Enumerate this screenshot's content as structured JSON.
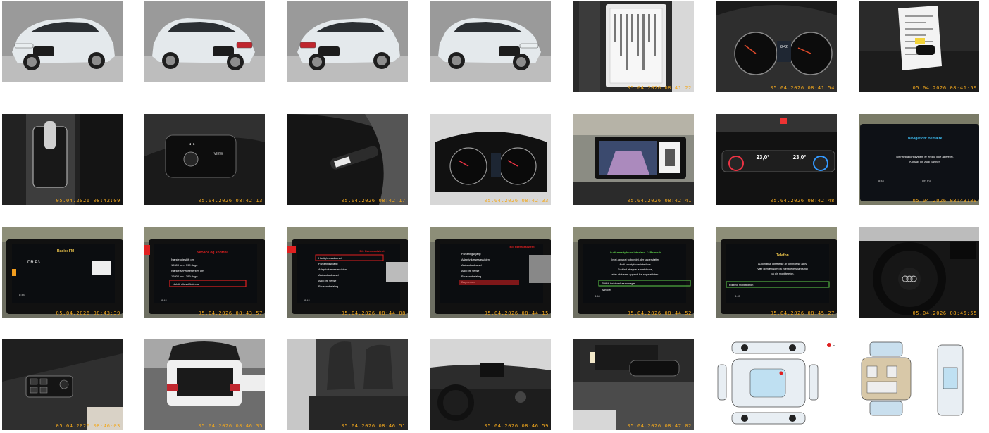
{
  "gallery": {
    "photos": [
      {
        "kind": "car-front-left",
        "stamp": ""
      },
      {
        "kind": "car-rear-left",
        "stamp": ""
      },
      {
        "kind": "car-rear-right",
        "stamp": ""
      },
      {
        "kind": "car-front-right",
        "stamp": ""
      },
      {
        "kind": "vin-plate",
        "stamp": "05.04.2026 08:41:22"
      },
      {
        "kind": "instrument-cluster",
        "stamp": "05.04.2026 08:41:54"
      },
      {
        "kind": "key-and-papers",
        "stamp": "05.04.2026 08:41:59"
      },
      {
        "kind": "gear-selector",
        "stamp": "05.04.2026 08:42:09"
      },
      {
        "kind": "steering-wheel-buttons",
        "stamp": "05.04.2026 08:42:13"
      },
      {
        "kind": "wiper-stalk",
        "stamp": "05.04.2026 08:42:17"
      },
      {
        "kind": "dashboard-gauges",
        "stamp": "05.04.2026 08:42:33"
      },
      {
        "kind": "reverse-camera-screen",
        "stamp": "05.04.2026 08:42:41"
      },
      {
        "kind": "climate-control",
        "stamp": "05.04.2026 08:42:48"
      },
      {
        "kind": "navigation-screen",
        "stamp": "05.04.2026 08:43:09"
      },
      {
        "kind": "radio-screen",
        "stamp": "05.04.2026 08:43:39"
      },
      {
        "kind": "service-screen",
        "stamp": "05.04.2026 08:43:57"
      },
      {
        "kind": "assist-menu-screen",
        "stamp": "05.04.2026 08:44:08"
      },
      {
        "kind": "assist-menu-screen-2",
        "stamp": "05.04.2026 08:44:15"
      },
      {
        "kind": "smartphone-screen",
        "stamp": "05.04.2026 08:44:52"
      },
      {
        "kind": "telefon-screen",
        "stamp": "05.04.2026 08:45:27"
      },
      {
        "kind": "steering-wheel-interior",
        "stamp": "05.04.2026 08:45:55"
      },
      {
        "kind": "door-window-controls",
        "stamp": "05.04.2026 08:46:03"
      },
      {
        "kind": "open-trunk",
        "stamp": "05.04.2026 08:46:35"
      },
      {
        "kind": "rear-seats",
        "stamp": "05.04.2026 08:46:51"
      },
      {
        "kind": "front-dashboard",
        "stamp": "05.04.2026 08:46:59"
      },
      {
        "kind": "interior-mirror",
        "stamp": "05.04.2026 08:47:02"
      },
      {
        "kind": "damage-diagram-exterior",
        "stamp": ""
      },
      {
        "kind": "damage-diagram-interior",
        "stamp": ""
      }
    ],
    "screen_texts": {
      "radio_title": "Radio: FM",
      "radio_station": "DR P3",
      "nav_title": "Navigation: Bemærk",
      "nav_line1": "Dit navigationssystem er endnu ikke aktiveret.",
      "nav_line2": "Kontakt din Audi partner.",
      "nav_station": "DR P3",
      "service_title": "Service og kontrol",
      "service_row1": "Næste olieskift om",
      "service_row2": "19300 km / 399 dage",
      "service_row3": "Næste serviceeftersyn om",
      "service_row4": "19300 km / 399 dage",
      "service_row5": "Nulstil olieskiftinterval",
      "assist_title": "Bil: Førerassistent",
      "assist_items": [
        "Hastighedsadvarsel",
        "Parkeringshjælp",
        "Adaptiv kørselsassistent",
        "Afstandsadvarsel",
        "Audi pre sense",
        "Pauseanbefaling"
      ],
      "assist2_items": [
        "Parkeringshjælp",
        "Adaptiv kørselsassistent",
        "Afstandsadvarsel",
        "Audi pre sense",
        "Pauseanbefaling",
        "Bagmenuer"
      ],
      "smart_title": "Audi smartphone interface",
      "smart_lines": [
        "Intet apparat forbundet, der understøtter",
        "Audi smartphone interface.",
        "Forbind et egnet smartphone,",
        "eller aktiver et apparat fra apparatlisten."
      ],
      "smart_btn1": "Skift til forbindelsesmanager",
      "smart_btn2": "Annuller",
      "tel_title": "Telefon",
      "tel_lines": [
        "Automatisk oprettelse af forbindelse aktiv.",
        "Vær opmærksom på eventuelle spørgsmål",
        "på din mobiltelefon."
      ],
      "tel_btn": "Forbind mobiltelefon",
      "clock1": "8:44",
      "clock2": "8:45",
      "clock3": "8:43",
      "temp_left": "23,0°",
      "temp_right": "23,0°",
      "cluster_clock": "8:42",
      "legend_mark": "B"
    },
    "colors": {
      "stamp": "#f2a81e",
      "car_body": "#dce3e6",
      "screen_red": "#e02020"
    }
  }
}
